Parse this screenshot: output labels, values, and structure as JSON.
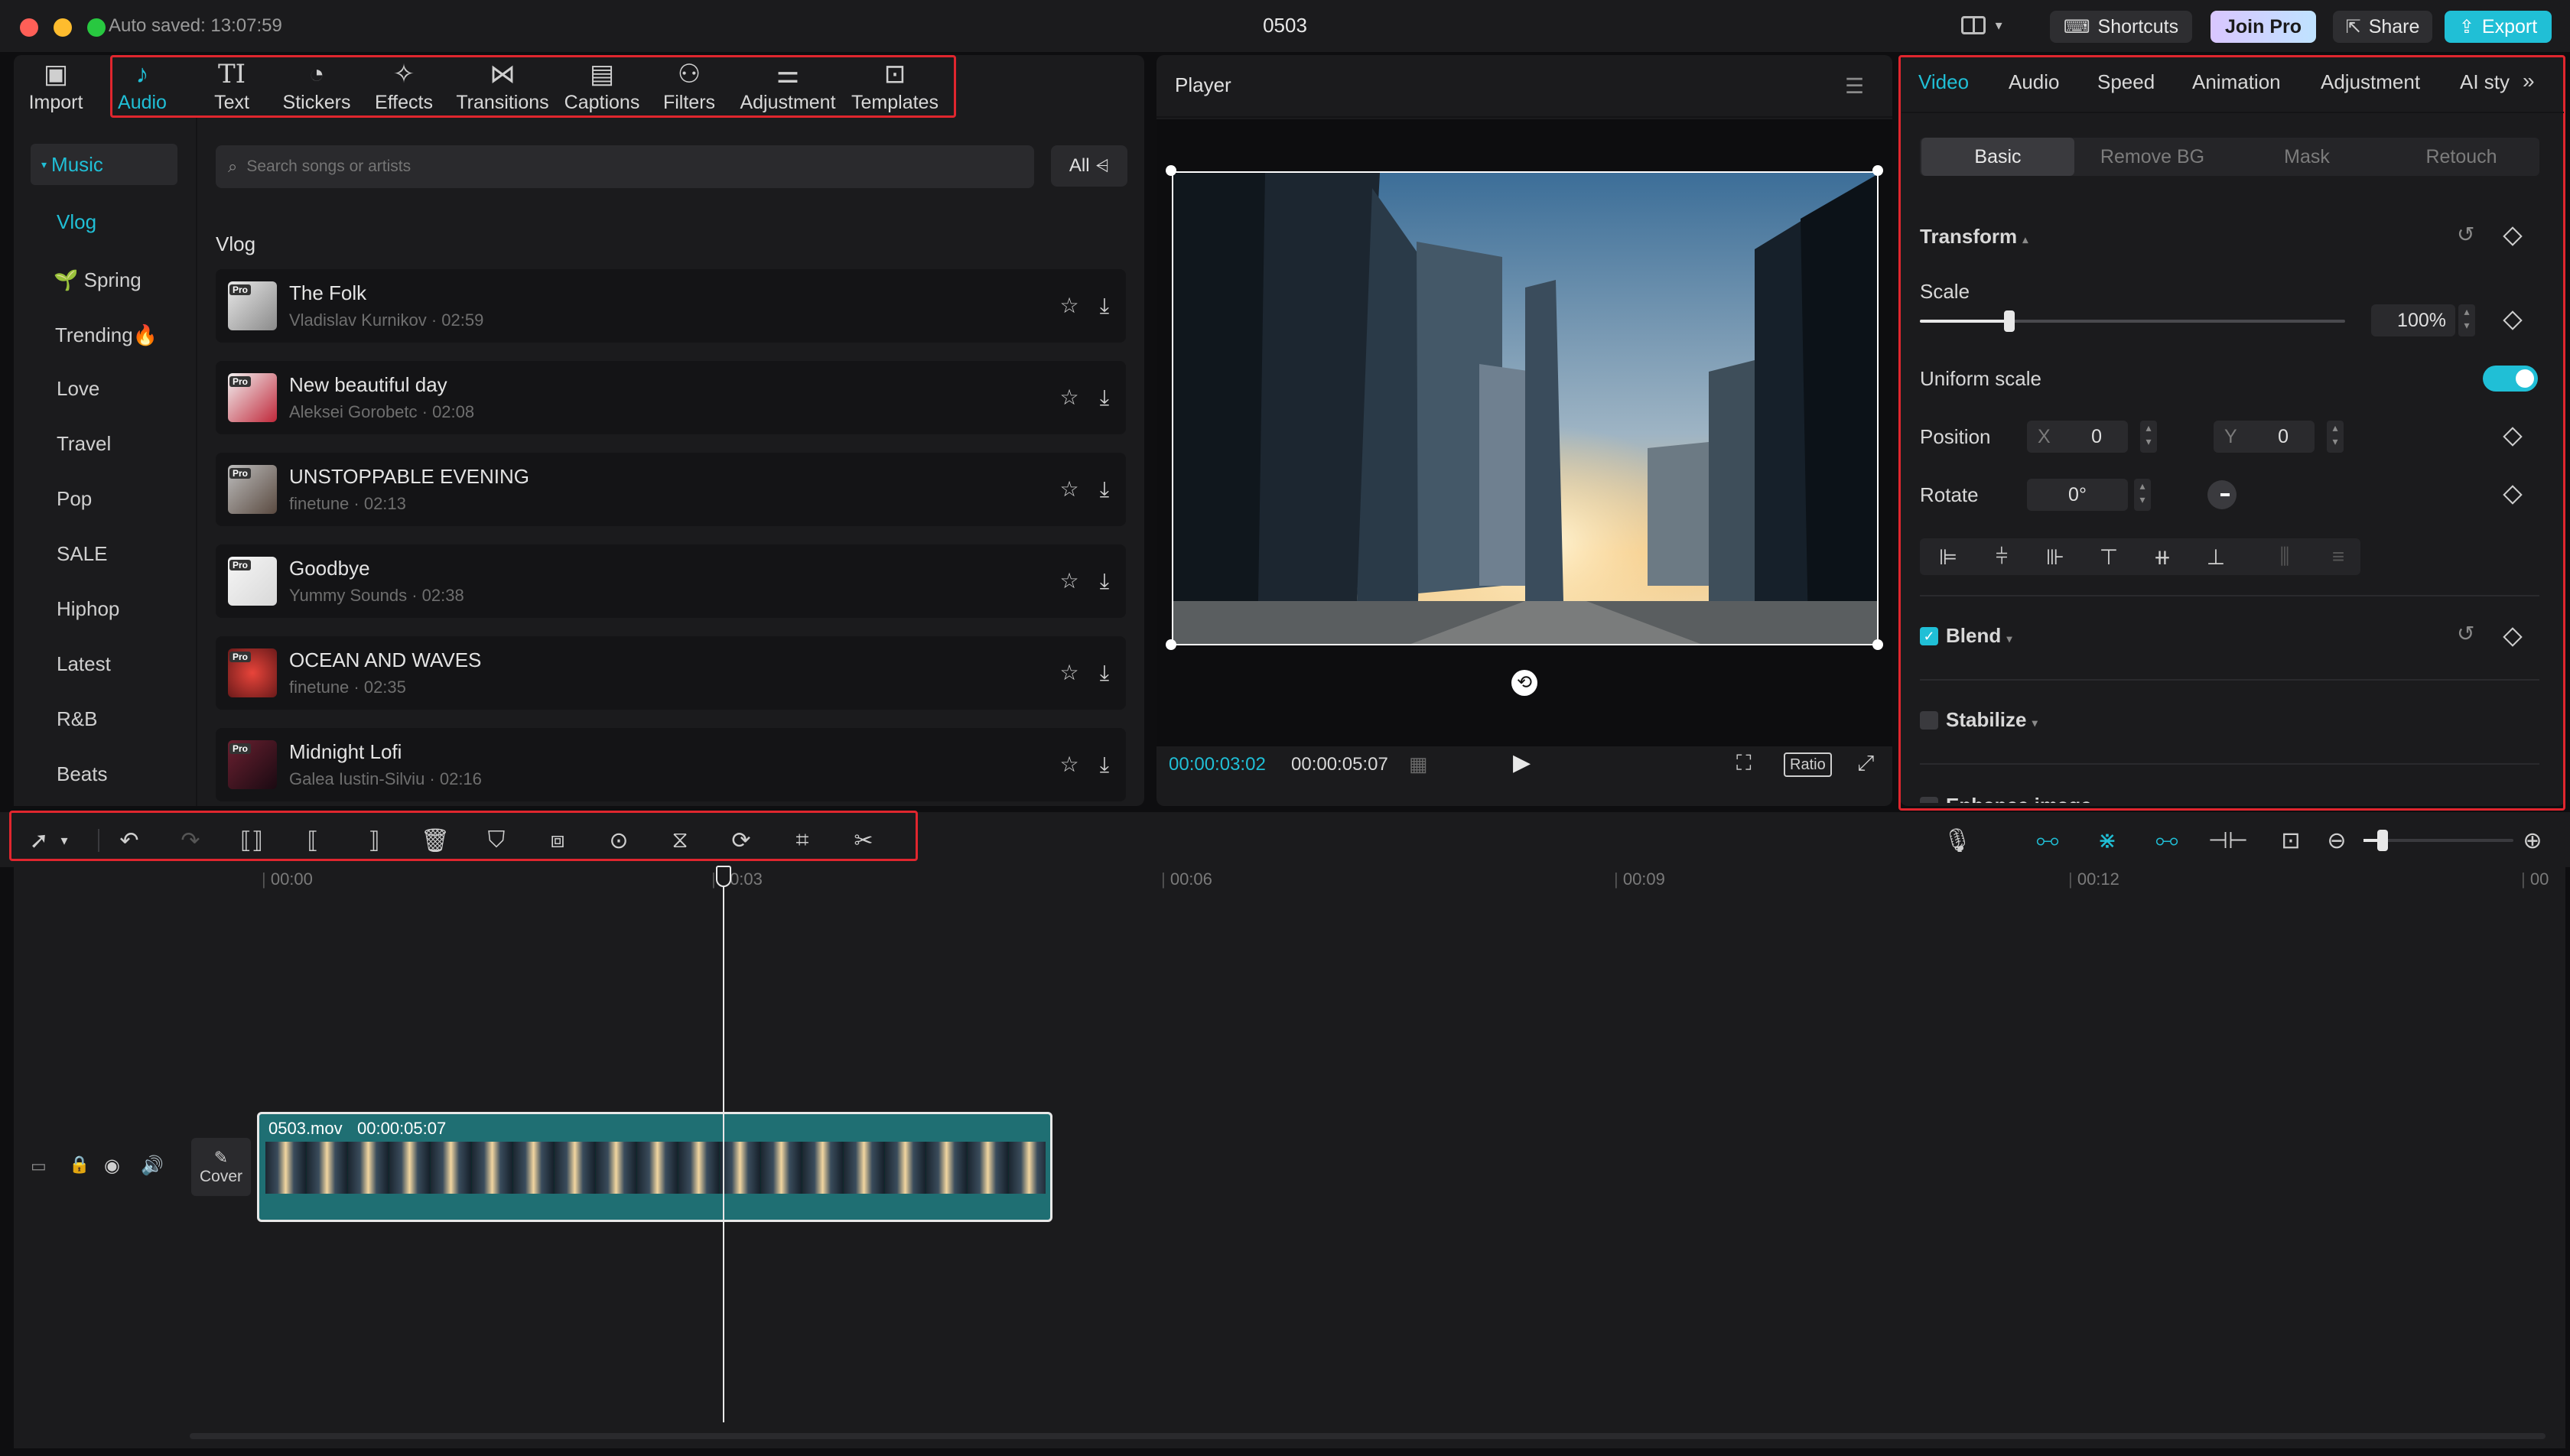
{
  "titlebar": {
    "autosave": "Auto saved: 13:07:59",
    "project_name": "0503",
    "shortcuts_label": "Shortcuts",
    "join_pro_label": "Join Pro",
    "share_label": "Share",
    "export_label": "Export"
  },
  "tools": {
    "import": "Import",
    "tabs": [
      "Audio",
      "Text",
      "Stickers",
      "Effects",
      "Transitions",
      "Captions",
      "Filters",
      "Adjustment",
      "Templates"
    ],
    "active": "Audio"
  },
  "sidebar": {
    "header": "Music",
    "items": [
      "Vlog",
      "🌱 Spring",
      "Trending🔥",
      "Love",
      "Travel",
      "Pop",
      "SALE",
      "Hiphop",
      "Latest",
      "R&B",
      "Beats"
    ],
    "active": "Vlog"
  },
  "search": {
    "placeholder": "Search songs or artists",
    "filter_label": "All"
  },
  "section_title": "Vlog",
  "songs": [
    {
      "title": "The Folk",
      "meta": "Vladislav Kurnikov · 02:59",
      "badge": "Pro"
    },
    {
      "title": "New beautiful day",
      "meta": "Aleksei Gorobetc · 02:08",
      "badge": "Pro"
    },
    {
      "title": "UNSTOPPABLE EVENING",
      "meta": "finetune · 02:13",
      "badge": "Pro"
    },
    {
      "title": "Goodbye",
      "meta": "Yummy Sounds · 02:38",
      "badge": "Pro"
    },
    {
      "title": "OCEAN AND WAVES",
      "meta": "finetune · 02:35",
      "badge": "Pro"
    },
    {
      "title": "Midnight Lofi",
      "meta": "Galea Iustin-Silviu · 02:16",
      "badge": "Pro"
    }
  ],
  "player": {
    "title": "Player",
    "current_time": "00:00:03:02",
    "total_time": "00:00:05:07",
    "ratio_label": "Ratio"
  },
  "inspector": {
    "tabs": [
      "Video",
      "Audio",
      "Speed",
      "Animation",
      "Adjustment",
      "AI sty"
    ],
    "active_tab": "Video",
    "subtabs": [
      "Basic",
      "Remove BG",
      "Mask",
      "Retouch"
    ],
    "active_subtab": "Basic",
    "transform_label": "Transform",
    "scale_label": "Scale",
    "scale_value": "100%",
    "scale_fraction": 0.21,
    "uniform_scale_label": "Uniform scale",
    "uniform_scale_on": true,
    "position_label": "Position",
    "pos_x_label": "X",
    "pos_x": "0",
    "pos_y_label": "Y",
    "pos_y": "0",
    "rotate_label": "Rotate",
    "rotate_value": "0°",
    "blend_label": "Blend",
    "blend_checked": true,
    "stabilize_label": "Stabilize",
    "stabilize_checked": false,
    "enhance_label": "Enhance image"
  },
  "timeline": {
    "ruler": [
      "00:00",
      "00:03",
      "00:06",
      "00:09",
      "00:12",
      "00"
    ],
    "cover_label": "Cover",
    "clip_name": "0503.mov",
    "clip_duration": "00:00:05:07"
  },
  "colors": {
    "accent": "#20bfd6",
    "highlight_box": "#e0262e",
    "clip": "#1f6f73"
  }
}
